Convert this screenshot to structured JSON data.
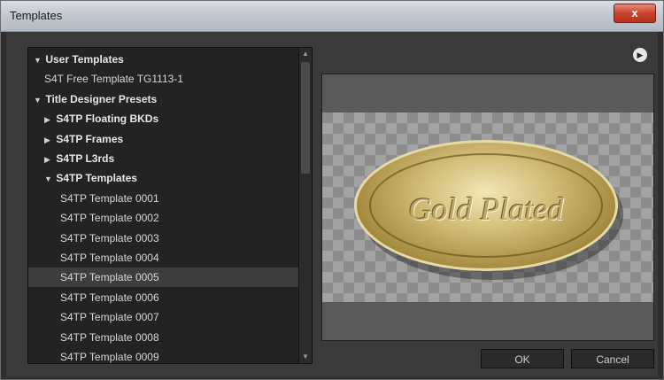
{
  "window": {
    "title": "Templates",
    "close_label": "x"
  },
  "tree": {
    "items": [
      {
        "label": "User Templates",
        "expanded": true,
        "bold": true,
        "indent": 0
      },
      {
        "label": "S4T Free Template TG1113-1",
        "bold": false,
        "indent": 1
      },
      {
        "label": "Title Designer Presets",
        "expanded": true,
        "bold": true,
        "indent": 0
      },
      {
        "label": "S4TP Floating BKDs",
        "expanded": false,
        "bold": true,
        "indent": 1
      },
      {
        "label": "S4TP Frames",
        "expanded": false,
        "bold": true,
        "indent": 1
      },
      {
        "label": "S4TP L3rds",
        "expanded": false,
        "bold": true,
        "indent": 1
      },
      {
        "label": "S4TP Templates",
        "expanded": true,
        "bold": true,
        "indent": 1
      },
      {
        "label": "S4TP Template 0001",
        "bold": false,
        "indent": 2
      },
      {
        "label": "S4TP Template 0002",
        "bold": false,
        "indent": 2
      },
      {
        "label": "S4TP Template 0003",
        "bold": false,
        "indent": 2
      },
      {
        "label": "S4TP Template 0004",
        "bold": false,
        "indent": 2
      },
      {
        "label": "S4TP Template 0005",
        "bold": false,
        "indent": 2,
        "selected": true
      },
      {
        "label": "S4TP Template 0006",
        "bold": false,
        "indent": 2
      },
      {
        "label": "S4TP Template 0007",
        "bold": false,
        "indent": 2
      },
      {
        "label": "S4TP Template 0008",
        "bold": false,
        "indent": 2
      },
      {
        "label": "S4TP Template 0009",
        "bold": false,
        "indent": 2
      }
    ]
  },
  "preview": {
    "text": "Gold Plated",
    "menu_icon": "play-circle-icon"
  },
  "buttons": {
    "ok": "OK",
    "cancel": "Cancel"
  },
  "colors": {
    "panel_bg": "#232323",
    "dialog_bg": "#3a3a3a",
    "gold": "#d3bd78",
    "selection": "#3d3d3d"
  }
}
